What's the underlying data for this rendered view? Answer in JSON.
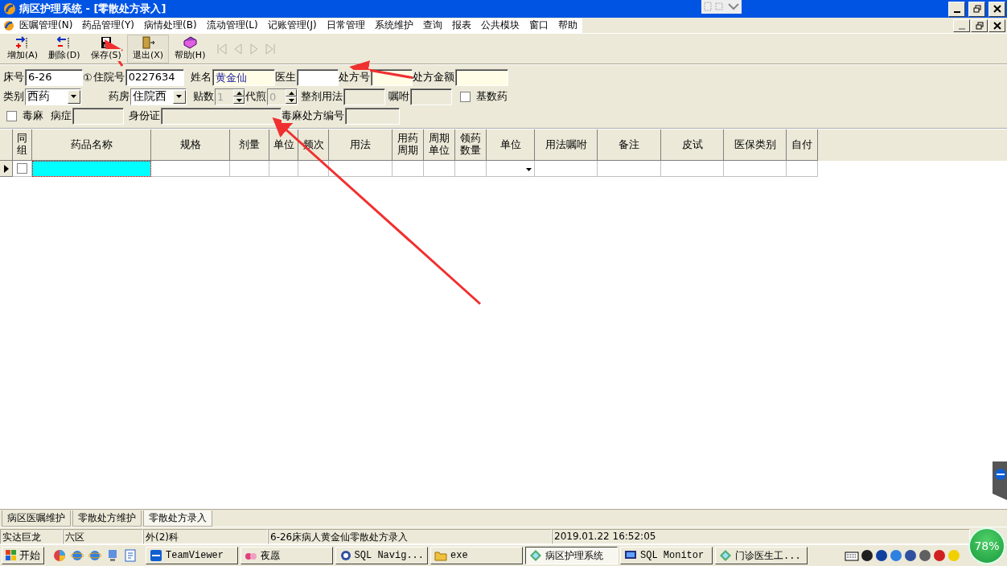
{
  "window": {
    "title": "病区护理系统 - [零散处方录入]"
  },
  "menu": [
    "医嘱管理(N)",
    "药品管理(Y)",
    "病情处理(B)",
    "流动管理(L)",
    "记账管理(J)",
    "日常管理",
    "系统维护",
    "查询",
    "报表",
    "公共模块",
    "窗口",
    "帮助"
  ],
  "toolbar": [
    {
      "kind": "add",
      "label": "增加(A)"
    },
    {
      "kind": "delete",
      "label": "删除(D)"
    },
    {
      "kind": "save",
      "label": "保存(S)"
    },
    {
      "kind": "exit",
      "label": "退出(X)"
    },
    {
      "kind": "help",
      "label": "帮助(H)"
    }
  ],
  "nav": [
    {
      "kind": "first",
      "disabled": true
    },
    {
      "kind": "prev",
      "disabled": true
    },
    {
      "kind": "next",
      "disabled": true
    },
    {
      "kind": "last",
      "disabled": true
    }
  ],
  "form": [
    [
      {
        "kind": "field",
        "label": "床号",
        "value": "6-26",
        "highlighted": false,
        "disabled": false
      },
      {
        "kind": "note",
        "label": "①"
      },
      {
        "kind": "field",
        "label": "住院号",
        "value": "0227634",
        "highlighted": false,
        "disabled": false
      },
      {
        "kind": "field",
        "label": "姓名",
        "value": "黄金仙",
        "highlighted": true,
        "disabled": false
      },
      {
        "kind": "field",
        "label": "医生",
        "highlighted": false,
        "disabled": false
      },
      {
        "kind": "field",
        "label": "处方号",
        "highlighted": true,
        "disabled": false
      },
      {
        "kind": "field",
        "label": "处方金额",
        "highlighted": true,
        "disabled": false
      }
    ],
    [
      {
        "kind": "combo",
        "label": "类别",
        "value": "西药"
      },
      {
        "kind": "combo",
        "label": "药房",
        "value": "住院西"
      },
      {
        "kind": "spin",
        "label": "贴数",
        "value": "1",
        "disabled": true
      },
      {
        "kind": "spin",
        "label": "代煎",
        "value": "0",
        "disabled": true
      },
      {
        "kind": "field",
        "label": "整剂用法",
        "highlighted": false,
        "disabled": true
      },
      {
        "kind": "field",
        "label": "嘱咐",
        "highlighted": false,
        "disabled": true
      },
      {
        "kind": "check",
        "label": "基数药",
        "checked": false
      }
    ],
    [
      {
        "kind": "check",
        "label": "毒麻",
        "checked": false
      },
      {
        "kind": "field",
        "label": "病症",
        "highlighted": false,
        "disabled": true
      },
      {
        "kind": "field",
        "label": "身份证",
        "highlighted": false,
        "disabled": true
      },
      {
        "kind": "field",
        "label": "毒麻处方编号",
        "highlighted": false,
        "disabled": true
      }
    ]
  ],
  "grid": {
    "columns": [
      {
        "label": "同组",
        "kind": "check"
      },
      {
        "label": "药品名称",
        "kind": "text"
      },
      {
        "label": "规格",
        "kind": "text"
      },
      {
        "label": "剂量",
        "kind": "text"
      },
      {
        "label": "单位",
        "kind": "text"
      },
      {
        "label": "频次",
        "kind": "text"
      },
      {
        "label": "用法",
        "kind": "text"
      },
      {
        "label": "用药周期",
        "kind": "text"
      },
      {
        "label": "周期单位",
        "kind": "text"
      },
      {
        "label": "领药数量",
        "kind": "text"
      },
      {
        "label": "单位",
        "kind": "combo"
      },
      {
        "label": "用法嘱咐",
        "kind": "text"
      },
      {
        "label": "备注",
        "kind": "text"
      },
      {
        "label": "皮试",
        "kind": "text"
      },
      {
        "label": "医保类别",
        "kind": "text"
      },
      {
        "label": "自付",
        "kind": "text"
      }
    ],
    "rows": [
      {
        "current": true,
        "checked": false,
        "cells": [
          {
            "selected": false
          },
          {
            "selected": true
          },
          {
            "selected": false
          },
          {
            "selected": false
          },
          {
            "selected": false
          },
          {
            "selected": false
          },
          {
            "selected": false
          },
          {
            "selected": false
          },
          {
            "selected": false
          },
          {
            "selected": false
          },
          {
            "selected": false
          },
          {
            "selected": false
          },
          {
            "selected": false
          },
          {
            "selected": false
          },
          {
            "selected": false
          },
          {
            "selected": false
          }
        ]
      }
    ]
  },
  "tabs": [
    {
      "label": "病区医嘱维护",
      "selected": false
    },
    {
      "label": "零散处方维护",
      "selected": false
    },
    {
      "label": "零散处方录入",
      "selected": true
    }
  ],
  "status_bar": [
    "实达巨龙",
    "六区",
    "外(2)科",
    "6-26床病人黄金仙零散处方录入",
    "2019.01.22 16:52:05"
  ],
  "taskbar": {
    "start": "开始",
    "tasks": [
      {
        "label": "TeamViewer",
        "kind": "teamviewer",
        "selected": false
      },
      {
        "label": "夜愿",
        "kind": "music",
        "selected": false
      },
      {
        "label": "SQL Navig...",
        "kind": "compass",
        "selected": false
      },
      {
        "label": "exe",
        "kind": "folder",
        "selected": false
      },
      {
        "label": "病区护理系统",
        "kind": "app",
        "selected": true
      },
      {
        "label": "SQL Monitor",
        "kind": "monitor",
        "selected": false
      },
      {
        "label": "门诊医生工...",
        "kind": "app",
        "selected": false
      }
    ],
    "meter": "78%"
  }
}
